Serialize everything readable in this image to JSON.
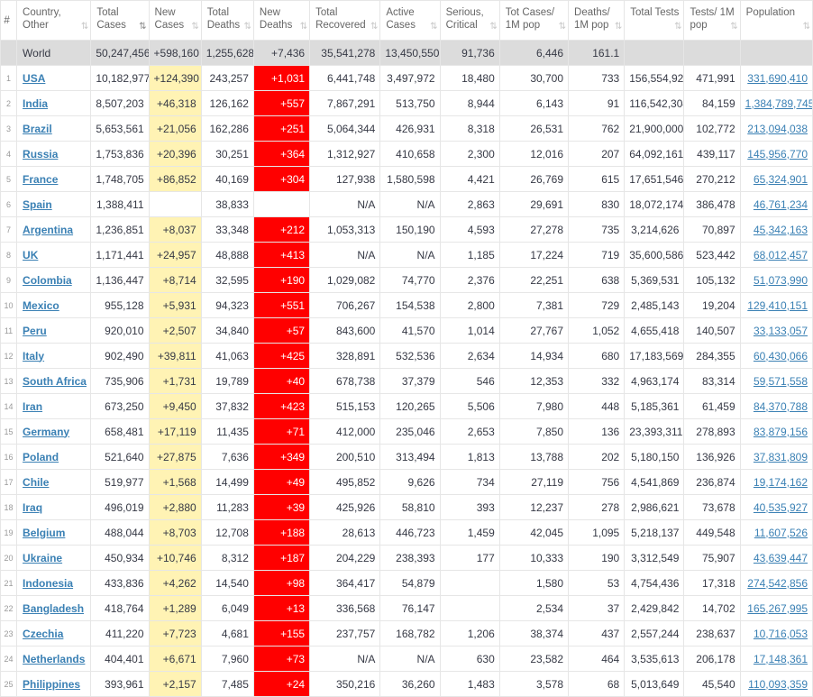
{
  "columns": [
    {
      "label": "#",
      "sort": ""
    },
    {
      "label": "Country, Other",
      "sort": "⇅"
    },
    {
      "label": "Total Cases",
      "sort": "⇅"
    },
    {
      "label": "New Cases",
      "sort": "⇅"
    },
    {
      "label": "Total Deaths",
      "sort": "⇅"
    },
    {
      "label": "New Deaths",
      "sort": "⇅"
    },
    {
      "label": "Total Recovered",
      "sort": "⇅"
    },
    {
      "label": "Active Cases",
      "sort": "⇅"
    },
    {
      "label": "Serious, Critical",
      "sort": "⇅"
    },
    {
      "label": "Tot Cases/ 1M pop",
      "sort": "⇅"
    },
    {
      "label": "Deaths/ 1M pop",
      "sort": "⇅"
    },
    {
      "label": "Total Tests",
      "sort": "⇅"
    },
    {
      "label": "Tests/ 1M pop",
      "sort": "⇅"
    },
    {
      "label": "Population",
      "sort": "⇅"
    }
  ],
  "world": {
    "country": "World",
    "total_cases": "50,247,456",
    "new_cases": "+598,160",
    "total_deaths": "1,255,628",
    "new_deaths": "+7,436",
    "total_recovered": "35,541,278",
    "active_cases": "13,450,550",
    "critical": "91,736",
    "cases_1m": "6,446",
    "deaths_1m": "161.1",
    "total_tests": "",
    "tests_1m": "",
    "population": ""
  },
  "rows": [
    {
      "idx": "1",
      "country": "USA",
      "total_cases": "10,182,977",
      "new_cases": "+124,390",
      "total_deaths": "243,257",
      "new_deaths": "+1,031",
      "total_recovered": "6,441,748",
      "active_cases": "3,497,972",
      "critical": "18,480",
      "cases_1m": "30,700",
      "deaths_1m": "733",
      "total_tests": "156,554,926",
      "tests_1m": "471,991",
      "population": "331,690,410"
    },
    {
      "idx": "2",
      "country": "India",
      "total_cases": "8,507,203",
      "new_cases": "+46,318",
      "total_deaths": "126,162",
      "new_deaths": "+557",
      "total_recovered": "7,867,291",
      "active_cases": "513,750",
      "critical": "8,944",
      "cases_1m": "6,143",
      "deaths_1m": "91",
      "total_tests": "116,542,304",
      "tests_1m": "84,159",
      "population": "1,384,789,745"
    },
    {
      "idx": "3",
      "country": "Brazil",
      "total_cases": "5,653,561",
      "new_cases": "+21,056",
      "total_deaths": "162,286",
      "new_deaths": "+251",
      "total_recovered": "5,064,344",
      "active_cases": "426,931",
      "critical": "8,318",
      "cases_1m": "26,531",
      "deaths_1m": "762",
      "total_tests": "21,900,000",
      "tests_1m": "102,772",
      "population": "213,094,038"
    },
    {
      "idx": "4",
      "country": "Russia",
      "total_cases": "1,753,836",
      "new_cases": "+20,396",
      "total_deaths": "30,251",
      "new_deaths": "+364",
      "total_recovered": "1,312,927",
      "active_cases": "410,658",
      "critical": "2,300",
      "cases_1m": "12,016",
      "deaths_1m": "207",
      "total_tests": "64,092,161",
      "tests_1m": "439,117",
      "population": "145,956,770"
    },
    {
      "idx": "5",
      "country": "France",
      "total_cases": "1,748,705",
      "new_cases": "+86,852",
      "total_deaths": "40,169",
      "new_deaths": "+304",
      "total_recovered": "127,938",
      "active_cases": "1,580,598",
      "critical": "4,421",
      "cases_1m": "26,769",
      "deaths_1m": "615",
      "total_tests": "17,651,546",
      "tests_1m": "270,212",
      "population": "65,324,901"
    },
    {
      "idx": "6",
      "country": "Spain",
      "total_cases": "1,388,411",
      "new_cases": "",
      "total_deaths": "38,833",
      "new_deaths": "",
      "total_recovered": "N/A",
      "active_cases": "N/A",
      "critical": "2,863",
      "cases_1m": "29,691",
      "deaths_1m": "830",
      "total_tests": "18,072,174",
      "tests_1m": "386,478",
      "population": "46,761,234"
    },
    {
      "idx": "7",
      "country": "Argentina",
      "total_cases": "1,236,851",
      "new_cases": "+8,037",
      "total_deaths": "33,348",
      "new_deaths": "+212",
      "total_recovered": "1,053,313",
      "active_cases": "150,190",
      "critical": "4,593",
      "cases_1m": "27,278",
      "deaths_1m": "735",
      "total_tests": "3,214,626",
      "tests_1m": "70,897",
      "population": "45,342,163"
    },
    {
      "idx": "8",
      "country": "UK",
      "total_cases": "1,171,441",
      "new_cases": "+24,957",
      "total_deaths": "48,888",
      "new_deaths": "+413",
      "total_recovered": "N/A",
      "active_cases": "N/A",
      "critical": "1,185",
      "cases_1m": "17,224",
      "deaths_1m": "719",
      "total_tests": "35,600,586",
      "tests_1m": "523,442",
      "population": "68,012,457"
    },
    {
      "idx": "9",
      "country": "Colombia",
      "total_cases": "1,136,447",
      "new_cases": "+8,714",
      "total_deaths": "32,595",
      "new_deaths": "+190",
      "total_recovered": "1,029,082",
      "active_cases": "74,770",
      "critical": "2,376",
      "cases_1m": "22,251",
      "deaths_1m": "638",
      "total_tests": "5,369,531",
      "tests_1m": "105,132",
      "population": "51,073,990"
    },
    {
      "idx": "10",
      "country": "Mexico",
      "total_cases": "955,128",
      "new_cases": "+5,931",
      "total_deaths": "94,323",
      "new_deaths": "+551",
      "total_recovered": "706,267",
      "active_cases": "154,538",
      "critical": "2,800",
      "cases_1m": "7,381",
      "deaths_1m": "729",
      "total_tests": "2,485,143",
      "tests_1m": "19,204",
      "population": "129,410,151"
    },
    {
      "idx": "11",
      "country": "Peru",
      "total_cases": "920,010",
      "new_cases": "+2,507",
      "total_deaths": "34,840",
      "new_deaths": "+57",
      "total_recovered": "843,600",
      "active_cases": "41,570",
      "critical": "1,014",
      "cases_1m": "27,767",
      "deaths_1m": "1,052",
      "total_tests": "4,655,418",
      "tests_1m": "140,507",
      "population": "33,133,057"
    },
    {
      "idx": "12",
      "country": "Italy",
      "total_cases": "902,490",
      "new_cases": "+39,811",
      "total_deaths": "41,063",
      "new_deaths": "+425",
      "total_recovered": "328,891",
      "active_cases": "532,536",
      "critical": "2,634",
      "cases_1m": "14,934",
      "deaths_1m": "680",
      "total_tests": "17,183,569",
      "tests_1m": "284,355",
      "population": "60,430,066"
    },
    {
      "idx": "13",
      "country": "South Africa",
      "total_cases": "735,906",
      "new_cases": "+1,731",
      "total_deaths": "19,789",
      "new_deaths": "+40",
      "total_recovered": "678,738",
      "active_cases": "37,379",
      "critical": "546",
      "cases_1m": "12,353",
      "deaths_1m": "332",
      "total_tests": "4,963,174",
      "tests_1m": "83,314",
      "population": "59,571,558"
    },
    {
      "idx": "14",
      "country": "Iran",
      "total_cases": "673,250",
      "new_cases": "+9,450",
      "total_deaths": "37,832",
      "new_deaths": "+423",
      "total_recovered": "515,153",
      "active_cases": "120,265",
      "critical": "5,506",
      "cases_1m": "7,980",
      "deaths_1m": "448",
      "total_tests": "5,185,361",
      "tests_1m": "61,459",
      "population": "84,370,788"
    },
    {
      "idx": "15",
      "country": "Germany",
      "total_cases": "658,481",
      "new_cases": "+17,119",
      "total_deaths": "11,435",
      "new_deaths": "+71",
      "total_recovered": "412,000",
      "active_cases": "235,046",
      "critical": "2,653",
      "cases_1m": "7,850",
      "deaths_1m": "136",
      "total_tests": "23,393,311",
      "tests_1m": "278,893",
      "population": "83,879,156"
    },
    {
      "idx": "16",
      "country": "Poland",
      "total_cases": "521,640",
      "new_cases": "+27,875",
      "total_deaths": "7,636",
      "new_deaths": "+349",
      "total_recovered": "200,510",
      "active_cases": "313,494",
      "critical": "1,813",
      "cases_1m": "13,788",
      "deaths_1m": "202",
      "total_tests": "5,180,150",
      "tests_1m": "136,926",
      "population": "37,831,809"
    },
    {
      "idx": "17",
      "country": "Chile",
      "total_cases": "519,977",
      "new_cases": "+1,568",
      "total_deaths": "14,499",
      "new_deaths": "+49",
      "total_recovered": "495,852",
      "active_cases": "9,626",
      "critical": "734",
      "cases_1m": "27,119",
      "deaths_1m": "756",
      "total_tests": "4,541,869",
      "tests_1m": "236,874",
      "population": "19,174,162"
    },
    {
      "idx": "18",
      "country": "Iraq",
      "total_cases": "496,019",
      "new_cases": "+2,880",
      "total_deaths": "11,283",
      "new_deaths": "+39",
      "total_recovered": "425,926",
      "active_cases": "58,810",
      "critical": "393",
      "cases_1m": "12,237",
      "deaths_1m": "278",
      "total_tests": "2,986,621",
      "tests_1m": "73,678",
      "population": "40,535,927"
    },
    {
      "idx": "19",
      "country": "Belgium",
      "total_cases": "488,044",
      "new_cases": "+8,703",
      "total_deaths": "12,708",
      "new_deaths": "+188",
      "total_recovered": "28,613",
      "active_cases": "446,723",
      "critical": "1,459",
      "cases_1m": "42,045",
      "deaths_1m": "1,095",
      "total_tests": "5,218,137",
      "tests_1m": "449,548",
      "population": "11,607,526"
    },
    {
      "idx": "20",
      "country": "Ukraine",
      "total_cases": "450,934",
      "new_cases": "+10,746",
      "total_deaths": "8,312",
      "new_deaths": "+187",
      "total_recovered": "204,229",
      "active_cases": "238,393",
      "critical": "177",
      "cases_1m": "10,333",
      "deaths_1m": "190",
      "total_tests": "3,312,549",
      "tests_1m": "75,907",
      "population": "43,639,447"
    },
    {
      "idx": "21",
      "country": "Indonesia",
      "total_cases": "433,836",
      "new_cases": "+4,262",
      "total_deaths": "14,540",
      "new_deaths": "+98",
      "total_recovered": "364,417",
      "active_cases": "54,879",
      "critical": "",
      "cases_1m": "1,580",
      "deaths_1m": "53",
      "total_tests": "4,754,436",
      "tests_1m": "17,318",
      "population": "274,542,856"
    },
    {
      "idx": "22",
      "country": "Bangladesh",
      "total_cases": "418,764",
      "new_cases": "+1,289",
      "total_deaths": "6,049",
      "new_deaths": "+13",
      "total_recovered": "336,568",
      "active_cases": "76,147",
      "critical": "",
      "cases_1m": "2,534",
      "deaths_1m": "37",
      "total_tests": "2,429,842",
      "tests_1m": "14,702",
      "population": "165,267,995"
    },
    {
      "idx": "23",
      "country": "Czechia",
      "total_cases": "411,220",
      "new_cases": "+7,723",
      "total_deaths": "4,681",
      "new_deaths": "+155",
      "total_recovered": "237,757",
      "active_cases": "168,782",
      "critical": "1,206",
      "cases_1m": "38,374",
      "deaths_1m": "437",
      "total_tests": "2,557,244",
      "tests_1m": "238,637",
      "population": "10,716,053"
    },
    {
      "idx": "24",
      "country": "Netherlands",
      "total_cases": "404,401",
      "new_cases": "+6,671",
      "total_deaths": "7,960",
      "new_deaths": "+73",
      "total_recovered": "N/A",
      "active_cases": "N/A",
      "critical": "630",
      "cases_1m": "23,582",
      "deaths_1m": "464",
      "total_tests": "3,535,613",
      "tests_1m": "206,178",
      "population": "17,148,361"
    },
    {
      "idx": "25",
      "country": "Philippines",
      "total_cases": "393,961",
      "new_cases": "+2,157",
      "total_deaths": "7,485",
      "new_deaths": "+24",
      "total_recovered": "350,216",
      "active_cases": "36,260",
      "critical": "1,483",
      "cases_1m": "3,578",
      "deaths_1m": "68",
      "total_tests": "5,013,649",
      "tests_1m": "45,540",
      "population": "110,093,359"
    }
  ],
  "colors": {
    "new_cases_bg": "#fff3b4",
    "new_deaths_bg": "#ff0000",
    "link": "#3a80b4",
    "world_bg": "#dcdcdc"
  }
}
